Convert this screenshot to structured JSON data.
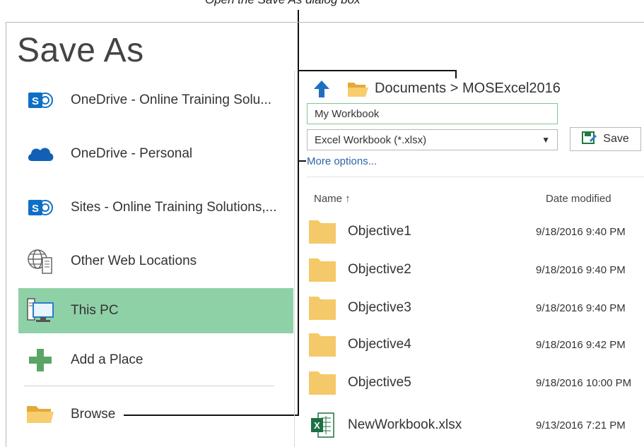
{
  "callout": {
    "text": "Open the Save As dialog box"
  },
  "title": "Save As",
  "places": [
    {
      "label": "OneDrive - Online Training Solu...",
      "icon": "sharepoint-icon"
    },
    {
      "label": "OneDrive - Personal",
      "icon": "onedrive-cloud-icon"
    },
    {
      "label": "Sites - Online Training Solutions,...",
      "icon": "sharepoint-icon"
    },
    {
      "label": "Other Web Locations",
      "icon": "globe-server-icon"
    },
    {
      "label": "This PC",
      "icon": "computer-icon",
      "selected": true
    },
    {
      "label": "Add a Place",
      "icon": "plus-icon"
    },
    {
      "label": "Browse",
      "icon": "folder-icon"
    }
  ],
  "breadcrumb": {
    "path": "Documents > MOSExcel2016"
  },
  "filename": {
    "value": "My Workbook"
  },
  "filetype": {
    "selected": "Excel Workbook (*.xlsx)"
  },
  "save_button": {
    "label": "Save"
  },
  "more_options": {
    "label": "More options..."
  },
  "columns": {
    "name": "Name ↑",
    "date": "Date modified"
  },
  "files": [
    {
      "name": "Objective1",
      "date": "9/18/2016 9:40 PM",
      "type": "folder"
    },
    {
      "name": "Objective2",
      "date": "9/18/2016 9:40 PM",
      "type": "folder"
    },
    {
      "name": "Objective3",
      "date": "9/18/2016 9:40 PM",
      "type": "folder"
    },
    {
      "name": "Objective4",
      "date": "9/18/2016 9:42 PM",
      "type": "folder"
    },
    {
      "name": "Objective5",
      "date": "9/18/2016 10:00 PM",
      "type": "folder"
    },
    {
      "name": "NewWorkbook.xlsx",
      "date": "9/13/2016 7:21 PM",
      "type": "excel"
    }
  ],
  "colors": {
    "selected": "#8fd1a7",
    "accent": "#2b63a8",
    "folder": "#f5c969",
    "excel": "#1d7044"
  }
}
